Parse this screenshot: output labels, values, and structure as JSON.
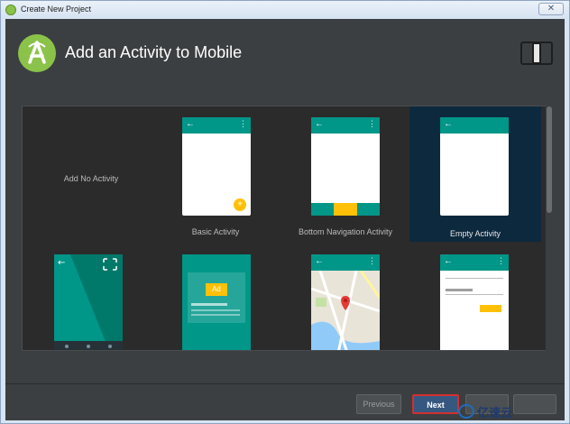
{
  "window": {
    "title": "Create New Project",
    "close_glyph": "✕"
  },
  "header": {
    "title": "Add an Activity to Mobile",
    "logo_icon": "android-studio-logo-icon",
    "device_icon": "phone-tablet-icon"
  },
  "gallery": {
    "tiles": [
      {
        "label": "Add No Activity",
        "kind": "none"
      },
      {
        "label": "Basic Activity",
        "kind": "basic"
      },
      {
        "label": "Bottom Navigation Activity",
        "kind": "bottom-nav"
      },
      {
        "label": "Empty Activity",
        "kind": "empty",
        "selected": true
      },
      {
        "label": "",
        "kind": "fullscreen"
      },
      {
        "label": "",
        "kind": "admob"
      },
      {
        "label": "",
        "kind": "maps"
      },
      {
        "label": "",
        "kind": "login"
      }
    ],
    "admob_badge": "Ad",
    "back_glyph": "←",
    "menu_glyph": "⋮",
    "fab_glyph": "+"
  },
  "footer": {
    "previous_label": "Previous",
    "next_label": "Next",
    "cancel_label": "",
    "finish_label": ""
  },
  "watermark": {
    "text": "亿速云"
  },
  "colors": {
    "accent": "#009688",
    "fab": "#ffc107",
    "selected_tile": "#0d293e",
    "next_highlight": "#d32f2f"
  }
}
